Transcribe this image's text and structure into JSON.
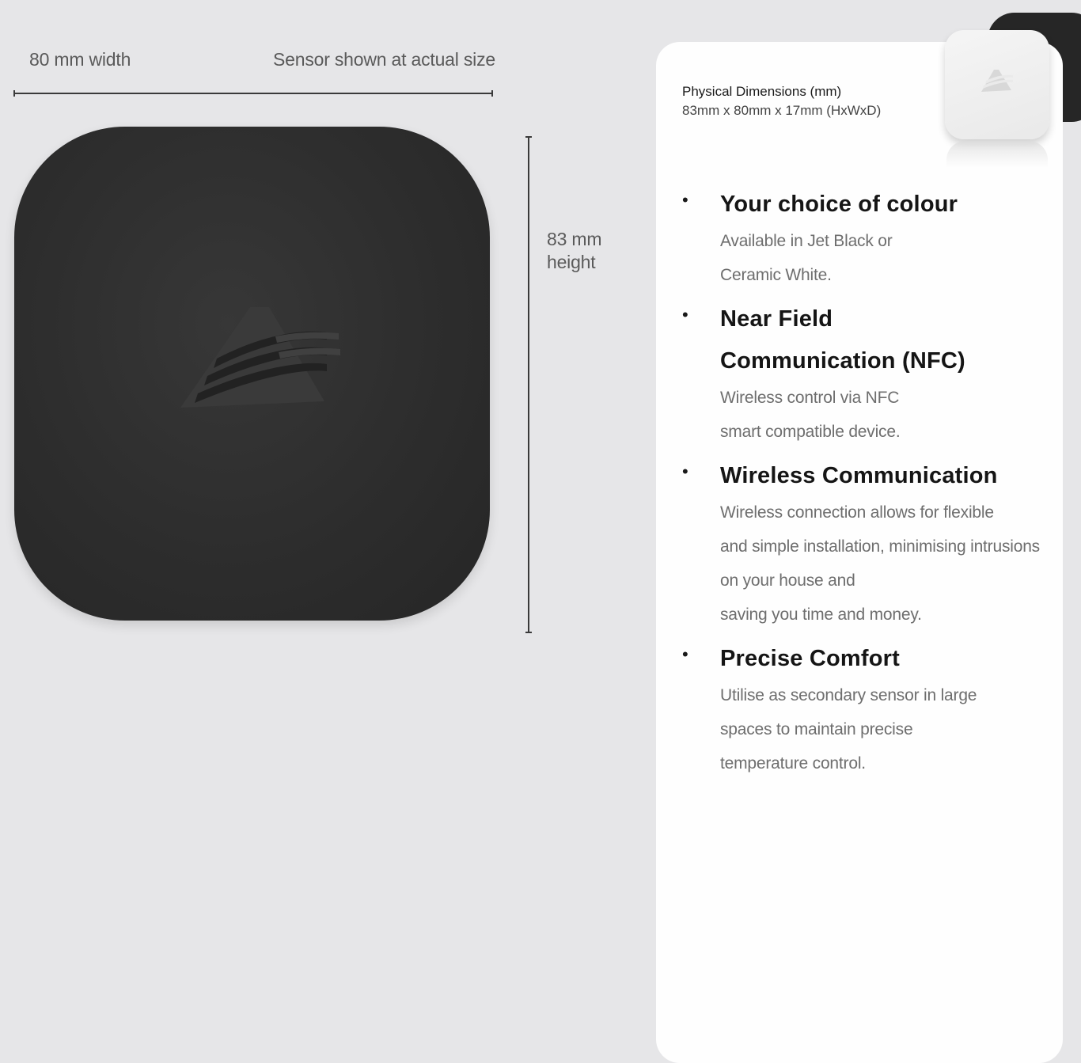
{
  "dimensions": {
    "width_label": "80 mm width",
    "actual_size_note": "Sensor shown at actual size",
    "height_label": "83 mm\nheight"
  },
  "colors": {
    "background": "#e6e6e8",
    "jet_black": "#2d2d2d",
    "ceramic_white": "#f0f0f0",
    "panel": "#fefefe"
  },
  "spec_panel": {
    "physical_dimensions_title": "Physical Dimensions (mm)",
    "physical_dimensions_value": "83mm x 80mm x 17mm (HxWxD)",
    "features": [
      {
        "title": "Your choice of colour",
        "description": "Available in Jet Black or\nCeramic White."
      },
      {
        "title": "Near Field\nCommunication (NFC)",
        "description": "Wireless control via NFC\nsmart compatible device."
      },
      {
        "title": "Wireless Communication",
        "description": "Wireless connection allows for flexible\nand simple installation, minimising intrusions\non your house and\nsaving you time and money."
      },
      {
        "title": "Precise Comfort",
        "description": "Utilise as secondary sensor in large\nspaces to maintain precise\ntemperature control."
      }
    ]
  }
}
